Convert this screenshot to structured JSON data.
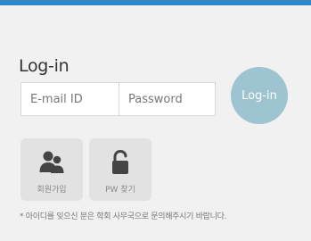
{
  "login": {
    "title": "Log-in",
    "email_placeholder": "E-mail ID",
    "password_placeholder": "Password",
    "submit_label": "Log-in"
  },
  "actions": {
    "join_label": "회원가입",
    "join_icon": "users-icon",
    "pw_label": "PW 찾기",
    "pw_icon": "unlock-icon"
  },
  "notice": "* 아이디를 잊으신 분은 학회 사무국으로 문의해주시기 바랍니다.",
  "colors": {
    "top_bar": "#2f86c9",
    "login_button": "#9dc4d0",
    "background": "#f1f1f1",
    "tile": "#e2e2e2",
    "icon": "#444444"
  }
}
